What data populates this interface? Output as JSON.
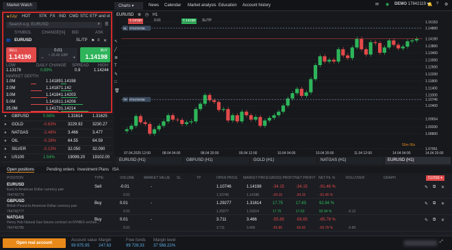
{
  "market_watch": {
    "title": "Market Watch",
    "fav": "FAV",
    "tabs": [
      "HOT",
      "STK",
      "FX",
      "IND",
      "CMD",
      "STC",
      "ETF and ot"
    ],
    "search_placeholder": "Search e.g. EURUSD",
    "cols": [
      "SYMBOL",
      "CHANGE[%]",
      "BID",
      "ASK"
    ],
    "symbol": "EURUSD",
    "sl_label": "SL/TP",
    "sell_label": "SELL",
    "sell_price": "1.14190",
    "buy_label": "BUY",
    "buy_price": "1.14198",
    "volume": "0.01",
    "volume_sub": "≈ 20.46 GBP",
    "stats_labels": [
      "LOW",
      "DAILY CHANGE",
      "SPREAD",
      "HIGH"
    ],
    "stats_values": [
      "1.13178",
      "0.89%",
      "0.9",
      "1.14244"
    ],
    "depth_title": "MARKET DEPTH",
    "depth": [
      [
        "1.0M",
        "1.14189",
        "1.14198"
      ],
      [
        "2.0M",
        "1.14187",
        "1.142"
      ],
      [
        "3.0M",
        "1.14184",
        "1.14203"
      ],
      [
        "5.0M",
        "1.14181",
        "1.14206"
      ],
      [
        "25.0M",
        "1.14173",
        "1.14214"
      ]
    ],
    "list": [
      {
        "s": "GBPUSD",
        "c": "0.56%",
        "b": "1.31614",
        "a": "1.31625",
        "up": true
      },
      {
        "s": "GOLD",
        "c": "-0.63%",
        "b": "3229.92",
        "a": "3230.27",
        "up": false
      },
      {
        "s": "NATGAS",
        "c": "-2.48%",
        "b": "3.466",
        "a": "3.477",
        "up": false
      },
      {
        "s": "OIL",
        "c": "-0.28%",
        "b": "64.55",
        "a": "64.59",
        "up": false
      },
      {
        "s": "SILVER",
        "c": "-0.13%",
        "b": "32.050",
        "a": "32.090",
        "up": false
      },
      {
        "s": "US100",
        "c": "1.54%",
        "b": "19099.20",
        "a": "19102.00",
        "up": true
      }
    ]
  },
  "nav": {
    "items": [
      "Charts",
      "News",
      "Calendar",
      "Market analysis",
      "Education",
      "Account history"
    ],
    "account": "DEMO",
    "account_id": "17842119"
  },
  "chart": {
    "symbol": "EURUSD",
    "timeframe": "H1",
    "ticks": [
      "1.15153",
      "1.14800",
      "1.14190",
      "1.13800",
      "1.13400",
      "1.13000",
      "1.12600",
      "1.12200",
      "1.11800",
      "1.11400",
      "1.11000",
      "1.10746",
      "1.10400",
      "1.09654",
      "1.09200",
      "1.08800",
      "1.07951"
    ],
    "dates": [
      "07.04.2025 12:00",
      "08.04 04:00",
      "08.04 20:00",
      "09.04 12:00",
      "10.04 04:00",
      "10.04 20:00",
      "11.04 12:00",
      "14.04 04:00"
    ],
    "right_date": "14.04 20:00",
    "countdown": "50m 06s",
    "line_labels": [
      "SL",
      "#74375755",
      "TP",
      "#74476750"
    ],
    "tabs": [
      "EURUSD (H1)",
      "GBPUSD (H1)",
      "GOLD (H1)",
      "NATGAS (H1)",
      "EURUSD (H1)"
    ]
  },
  "positions": {
    "tabs": [
      "Open positions",
      "Pending orders",
      "Investment Plans",
      "ISA"
    ],
    "cols": [
      "POSITION",
      "TYPE",
      "VOLUME",
      "MARKET VALUE",
      "SL",
      "TP",
      "OPEN PRICE",
      "MARKET PRICE",
      "GROSS PROFIT",
      "NET PROFIT",
      "NET P/L %",
      "ROLLOVER",
      "GRAPH"
    ],
    "close": "CLOSE",
    "rows": [
      {
        "sym": "EURUSD",
        "desc": "Euro to American Dollar currency pair",
        "type": "Sell",
        "vol": "-0.01",
        "mv": "-",
        "open": "1.10746",
        "mkt": "1.14198",
        "gp": "-34.15",
        "np": "-34.15",
        "pl": "-91.46 %",
        "id": "764742776",
        "vol2": "0.01",
        "open2": "1.10746",
        "mkt2": "1.14198",
        "gp2": "-34.15",
        "np2": "-34.15",
        "pl2": "-91.46 %",
        "gain": false
      },
      {
        "sym": "GBPUSD",
        "desc": "British Pound to American Dollar currency pair",
        "type": "Buy",
        "vol": "0.01",
        "mv": "-",
        "open": "1.29277",
        "mkt": "1.31614",
        "gp": "17.75",
        "np": "17.63",
        "pl": "92.94 %",
        "id": "764742777",
        "vol2": "0.01",
        "open2": "1.29277",
        "mkt2": "1.31614",
        "gp2": "17.75",
        "np2": "17.63",
        "pl2": "92.94 %",
        "rollover": "-0.12",
        "gain": true
      },
      {
        "sym": "NATGAS",
        "desc": "Henry Hub Natural Gas futures contract on NYMEX exchan...",
        "type": "Buy",
        "vol": "0.01",
        "mv": "-",
        "open": "3.711",
        "mkt": "3.466",
        "gp": "-55.85",
        "np": "-56.65",
        "pl": "-65.78 %",
        "id": "764742785",
        "vol2": "0.01",
        "open2": "3.711",
        "mkt2": "3.466",
        "gp2": "-55.85",
        "np2": "-56.65",
        "pl2": "-65.78 %",
        "rollover": "-0.80",
        "gain": false
      }
    ]
  },
  "footer": {
    "open_account": "Open real account",
    "labels": [
      "Account value",
      "Margin",
      "Free funds",
      "Margin level"
    ],
    "values": [
      "99 975.95",
      "247.63",
      "99 728.33",
      "37 568.22%"
    ]
  },
  "chart_data": {
    "type": "candlestick",
    "series": [
      {
        "name": "EURUSD",
        "values": [
          1.0905,
          1.0925,
          1.098,
          1.0945,
          1.0935,
          1.088,
          1.0905,
          1.0925,
          1.095,
          1.0985,
          1.096,
          1.0958,
          1.0935,
          1.0945,
          1.095,
          1.102,
          1.105,
          1.11,
          1.107,
          1.106,
          1.1015,
          1.102,
          1.0955,
          1.0985,
          1.095,
          1.1005,
          1.0985,
          1.096,
          1.0975,
          1.0925,
          1.0955,
          1.097,
          1.0985,
          1.1005,
          1.104,
          1.108,
          1.111,
          1.1135,
          1.1095,
          1.1115,
          1.119,
          1.127,
          1.132,
          1.129,
          1.13,
          1.129,
          1.136,
          1.1325,
          1.131,
          1.137,
          1.142,
          1.136,
          1.133,
          1.14,
          1.1395,
          1.134,
          1.137,
          1.141,
          1.1385,
          1.1365,
          1.1375,
          1.1405,
          1.141,
          1.1419
        ]
      }
    ],
    "ylim": [
      1.07951,
      1.15153
    ]
  }
}
